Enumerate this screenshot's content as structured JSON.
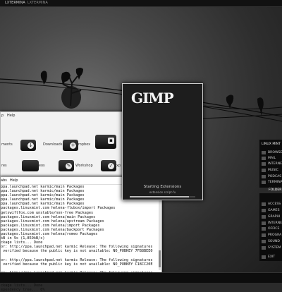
{
  "top_panel": {
    "tabs": [
      "LXTERMINA",
      "LXTERMINA"
    ]
  },
  "file_manager": {
    "menu": [
      "p",
      "Help"
    ],
    "items": [
      {
        "label": "ments"
      },
      {
        "label": "Downloads"
      },
      {
        "label": "Dropbox"
      },
      {
        "label": "res"
      },
      {
        "label": "Videos"
      },
      {
        "label": "Workshop"
      },
      {
        "label": "xp"
      }
    ]
  },
  "terminal": {
    "menu": [
      "abs",
      "Help"
    ],
    "lines": [
      "ppa.launchpad.net karmic/main Packages",
      "ppa.launchpad.net karmic/main Packages",
      "ppa.launchpad.net karmic/main Packages",
      "ppa.launchpad.net karmic/main Packages",
      "ppa.launchpad.net karmic/main Packages",
      "packages.linuxmint.com helena-flubox/import Packages",
      "getswiftfox.com unstable/non-free Packages",
      "packages.linuxmint.com helena/main Packages",
      "packages.linuxmint.com helena/upstream Packages",
      "packages.linuxmint.com helena/import Packages",
      "packages.linuxmint.com helena/backport Packages",
      "packages.linuxmint.com helena/romeo Packages",
      "kB in 9s (1,859kB/s)",
      "ckage lists... Done",
      "or: http://ppa.launchpad.net karmic Release: The following signatures",
      " verified because the public key is not available: NO_PUBKEY 7FB8BEE0",
      "",
      "or: http://ppa.launchpad.net karmic Release: The following signatures",
      " verified because the public key is not available: NO_PUBKEY C18CC20E",
      "",
      "or: http://ppa.launchpad.net karmic Release: The following signatures",
      " verified because the public key is not available: NO_PUBKEY 8930C235",
      "",
      "ckage lists... Done",
      "ependency tree... 0%"
    ]
  },
  "gimp_splash": {
    "logo": "GIMP",
    "status": "Starting Extensions",
    "substatus": "extension script-fu",
    "progress": 0.9
  },
  "start_menu": {
    "title": "LINUX MINT",
    "items": [
      "BROWSE",
      "MAIL",
      "INTERNE",
      "MUSIC",
      "PODCAS",
      "TERMINA",
      "FOLDER",
      "ACCESS",
      "GAMES",
      "GRAPHI",
      "INTERNE",
      "OFFICE",
      "PROGRA",
      "SOUND",
      "SYSTEM",
      "EXIT"
    ],
    "selected_index": 6
  }
}
